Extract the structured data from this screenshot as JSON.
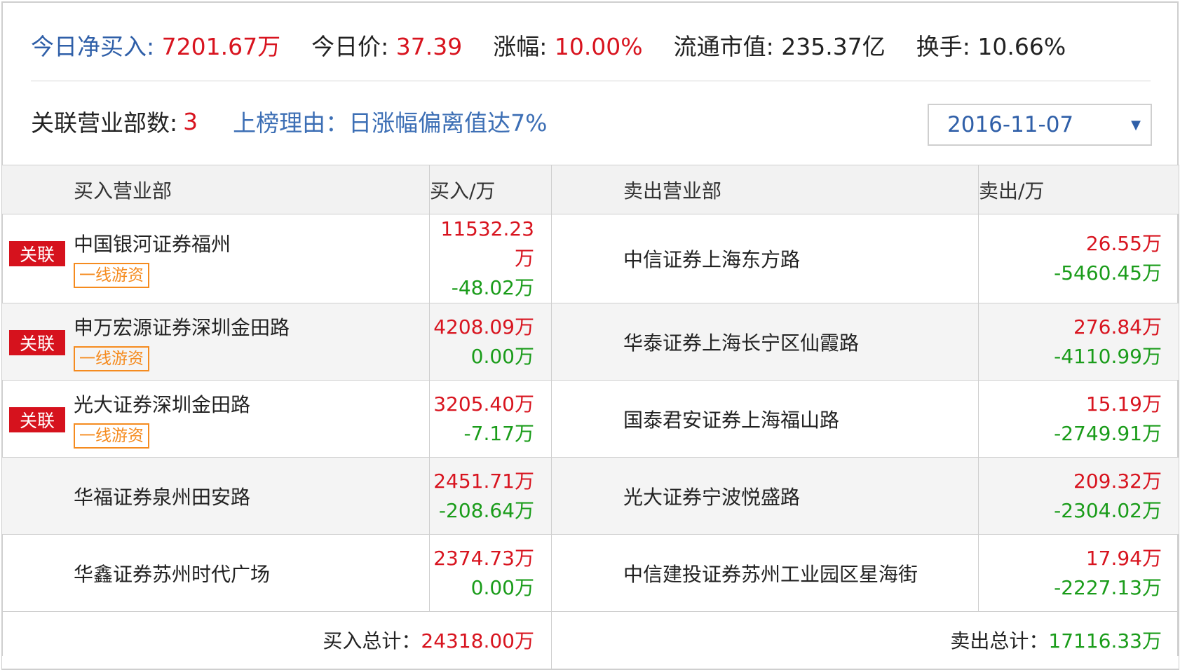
{
  "summary": {
    "net_buy_label": "今日净买入:",
    "net_buy_value": "7201.67万",
    "price_label": "今日价:",
    "price_value": "37.39",
    "change_label": "涨幅:",
    "change_value": "10.00%",
    "mktcap_label": "流通市值:",
    "mktcap_value": "235.37亿",
    "turnover_label": "换手:",
    "turnover_value": "10.66%"
  },
  "meta": {
    "dept_count_label": "关联营业部数:",
    "dept_count_value": "3",
    "reason": "上榜理由：日涨幅偏离值达7%"
  },
  "date_select": {
    "value": "2016-11-07"
  },
  "table": {
    "headers": {
      "buy_dept": "买入营业部",
      "buy_amt": "买入/万",
      "sell_dept": "卖出营业部",
      "sell_amt": "卖出/万"
    },
    "rows": [
      {
        "buy_name": "中国银河证券福州",
        "badge": "关联",
        "tag": "一线游资",
        "buy_value": "11532.23万",
        "buy_net": "-48.02万",
        "sell_name": "中信证券上海东方路",
        "sell_value": "26.55万",
        "sell_net": "-5460.45万"
      },
      {
        "buy_name": "申万宏源证券深圳金田路",
        "badge": "关联",
        "tag": "一线游资",
        "buy_value": "4208.09万",
        "buy_net": "0.00万",
        "sell_name": "华泰证券上海长宁区仙霞路",
        "sell_value": "276.84万",
        "sell_net": "-4110.99万"
      },
      {
        "buy_name": "光大证券深圳金田路",
        "badge": "关联",
        "tag": "一线游资",
        "buy_value": "3205.40万",
        "buy_net": "-7.17万",
        "sell_name": "国泰君安证券上海福山路",
        "sell_value": "15.19万",
        "sell_net": "-2749.91万"
      },
      {
        "buy_name": "华福证券泉州田安路",
        "badge": "",
        "tag": "",
        "buy_value": "2451.71万",
        "buy_net": "-208.64万",
        "sell_name": "光大证券宁波悦盛路",
        "sell_value": "209.32万",
        "sell_net": "-2304.02万"
      },
      {
        "buy_name": "华鑫证券苏州时代广场",
        "badge": "",
        "tag": "",
        "buy_value": "2374.73万",
        "buy_net": "0.00万",
        "sell_name": "中信建投证券苏州工业园区星海街",
        "sell_value": "17.94万",
        "sell_net": "-2227.13万"
      }
    ],
    "totals": {
      "buy_label": "买入总计：",
      "buy_value": "24318.00万",
      "sell_label": "卖出总计：",
      "sell_value": "17116.33万"
    }
  },
  "colors": {
    "red": "#d8141f",
    "green": "#1a9c1a",
    "blue": "#2f5fa8",
    "orange": "#f58b1f"
  }
}
